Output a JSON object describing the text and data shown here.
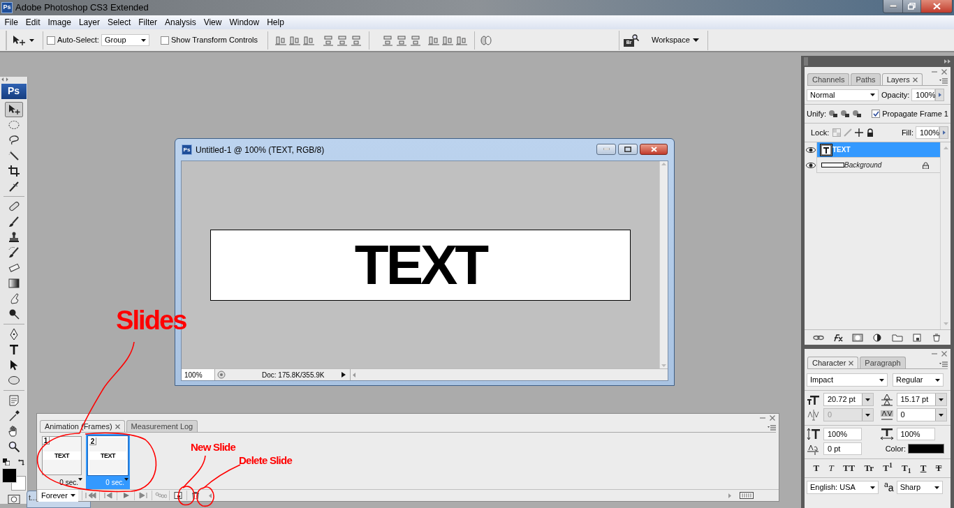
{
  "app": {
    "icon": "Ps",
    "title": "Adobe Photoshop CS3 Extended"
  },
  "menu": [
    "File",
    "Edit",
    "Image",
    "Layer",
    "Select",
    "Filter",
    "Analysis",
    "View",
    "Window",
    "Help"
  ],
  "options_bar": {
    "auto_select": {
      "label": "Auto-Select:",
      "checked": false
    },
    "auto_select_target": "Group",
    "transform_controls": {
      "label": "Show Transform Controls",
      "checked": false
    },
    "bridge_label": "Br",
    "workspace": "Workspace"
  },
  "toolbox": {
    "logo": "Ps",
    "tools": [
      {
        "selected": true
      },
      {
        "selected": false
      },
      {
        "selected": false
      },
      {
        "selected": false
      },
      {
        "selected": false
      },
      {
        "selected": false
      },
      {
        "selected": false
      },
      {
        "selected": false
      },
      {
        "selected": false
      },
      {
        "selected": false
      },
      {
        "selected": false
      },
      {
        "selected": false
      },
      {
        "selected": false
      },
      {
        "selected": false
      },
      {
        "selected": false
      },
      {
        "selected": false
      },
      {
        "selected": false
      },
      {
        "selected": false
      },
      {
        "selected": false
      },
      {
        "selected": false
      },
      {
        "selected": false
      },
      {
        "selected": false
      }
    ]
  },
  "document": {
    "icon": "Ps",
    "title": "Untitled-1 @ 100% (TEXT, RGB/8)",
    "canvas_text": "TEXT",
    "zoom": "100%",
    "doc_size": "Doc: 175.8K/355.9K"
  },
  "layers_panel": {
    "tabs": [
      {
        "label": "Channels",
        "selected": false
      },
      {
        "label": "Paths",
        "selected": false
      },
      {
        "label": "Layers",
        "selected": true
      }
    ],
    "blend_mode": "Normal",
    "opacity_label": "Opacity:",
    "opacity": "100%",
    "unify_label": "Unify:",
    "propagate": {
      "label": "Propagate Frame 1",
      "checked": true
    },
    "lock_label": "Lock:",
    "fill_label": "Fill:",
    "fill": "100%",
    "layers": [
      {
        "name": "TEXT",
        "kind": "text",
        "selected": true,
        "visible": true,
        "locked": false
      },
      {
        "name": "Background",
        "kind": "background",
        "selected": false,
        "visible": true,
        "locked": true
      }
    ]
  },
  "character_panel": {
    "tabs": [
      {
        "label": "Character",
        "selected": true
      },
      {
        "label": "Paragraph",
        "selected": false
      }
    ],
    "font_family": "Impact",
    "font_style": "Regular",
    "size": "20.72 pt",
    "leading": "15.17 pt",
    "kerning": {
      "value": "0",
      "disabled": true
    },
    "tracking": {
      "value": "0",
      "disabled": false
    },
    "vertical_scale": "100%",
    "horizontal_scale": "100%",
    "baseline_shift": "0 pt",
    "color_label": "Color:",
    "color": "#000000",
    "style_buttons": [
      {
        "label": "T",
        "kind": "bold"
      },
      {
        "label": "T",
        "kind": "italic"
      },
      {
        "label": "TT",
        "kind": "allcaps"
      },
      {
        "label": "Tr",
        "kind": "smallcaps"
      },
      {
        "label": "T$^{1}$",
        "kind": "superscript"
      },
      {
        "label": "T$_{1}$",
        "kind": "subscript"
      },
      {
        "label": "T",
        "kind": "underline"
      },
      {
        "label": "T",
        "kind": "strikethrough"
      }
    ],
    "language": "English: USA",
    "antialias_label": "$^{a}$a",
    "antialias": "Sharp"
  },
  "animation_panel": {
    "tabs": [
      {
        "label": "Animation (Frames)",
        "selected": true
      },
      {
        "label": "Measurement Log",
        "selected": false
      }
    ],
    "frames": [
      {
        "number": "1",
        "thumbnail_text": "TEXT",
        "delay": "0 sec.",
        "selected": false
      },
      {
        "number": "2",
        "thumbnail_text": "TEXT",
        "delay": "0 sec.",
        "selected": true
      }
    ],
    "loop": "Forever"
  },
  "minimized_window": {
    "title": "t..."
  },
  "annotations": [
    {
      "text": "Slides",
      "kind": "large"
    },
    {
      "text": "New Slide",
      "kind": "small"
    },
    {
      "text": "Delete Slide",
      "kind": "small"
    }
  ]
}
